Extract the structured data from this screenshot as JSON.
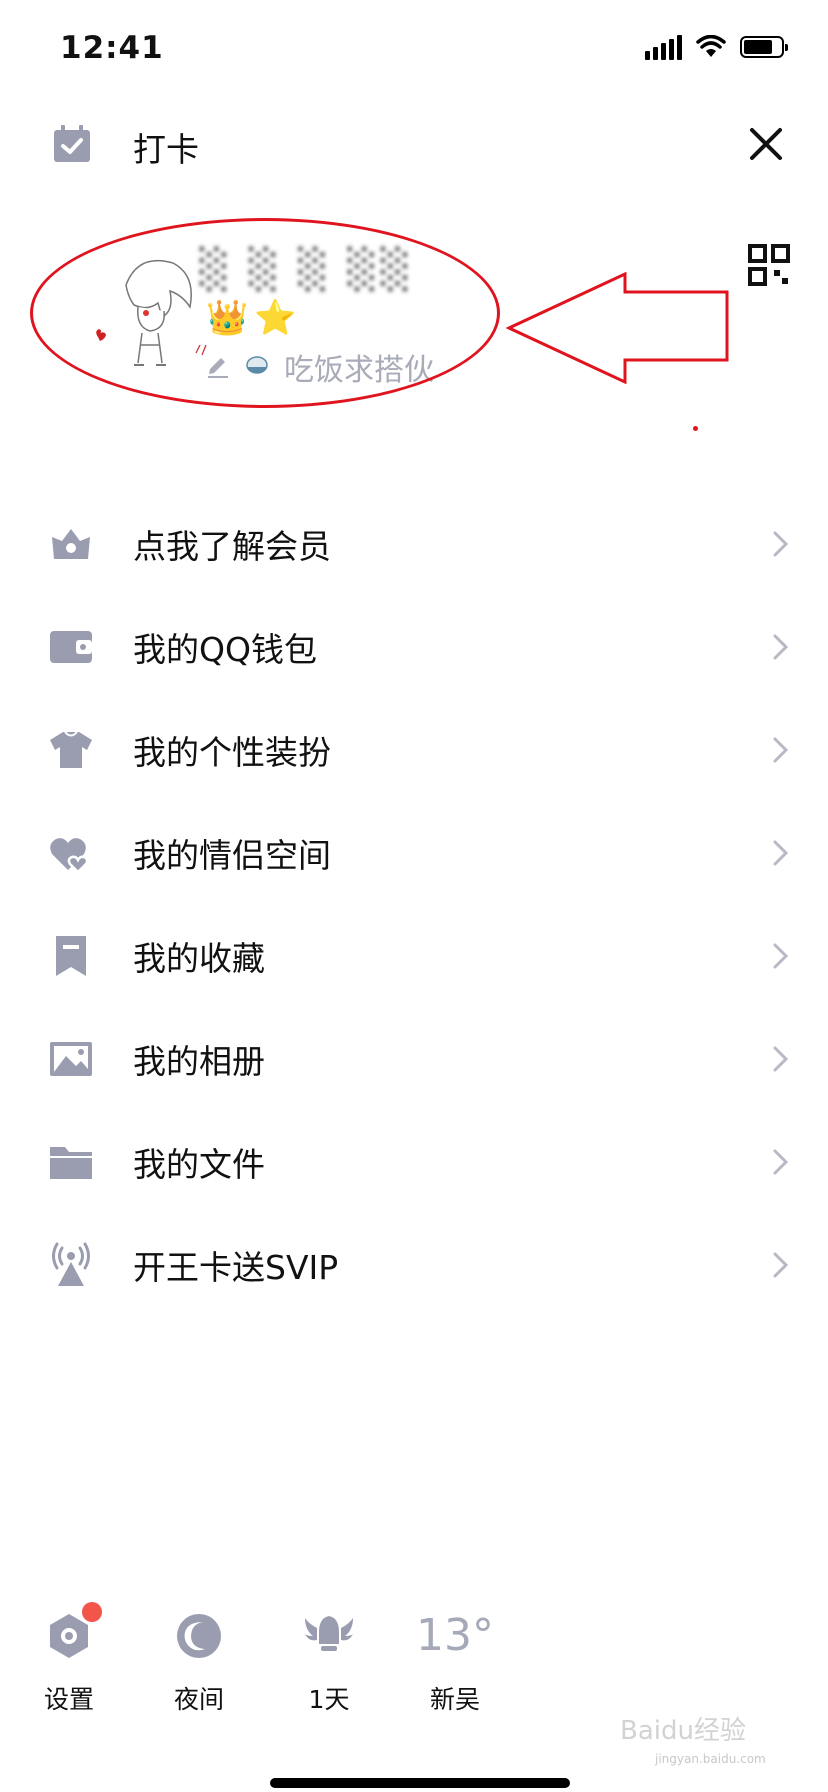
{
  "status_bar": {
    "time": "12:41"
  },
  "header": {
    "checkin_label": "打卡"
  },
  "profile": {
    "nickname": "░ ░  ░ ░░",
    "badges": [
      "👑",
      "⭐"
    ],
    "signature": "吃饭求搭伙"
  },
  "menu": {
    "items": [
      {
        "label": "点我了解会员",
        "icon": "vip-crown-icon"
      },
      {
        "label": "我的QQ钱包",
        "icon": "wallet-icon"
      },
      {
        "label": "我的个性装扮",
        "icon": "tshirt-icon"
      },
      {
        "label": "我的情侣空间",
        "icon": "hearts-icon"
      },
      {
        "label": "我的收藏",
        "icon": "bookmark-icon"
      },
      {
        "label": "我的相册",
        "icon": "photo-album-icon"
      },
      {
        "label": "我的文件",
        "icon": "folder-icon"
      },
      {
        "label": "开王卡送SVIP",
        "icon": "broadcast-tower-icon"
      }
    ]
  },
  "bottom_bar": {
    "settings_label": "设置",
    "night_label": "夜间",
    "days_label": "1天",
    "temperature": "13°",
    "city_label": "新吴"
  },
  "watermark": {
    "text": "Baidu经验",
    "sub": "jingyan.baidu.com"
  },
  "colors": {
    "icon_gray": "#9a9db0",
    "annotation_red": "#e0141e",
    "badge_red": "#f2564a"
  }
}
